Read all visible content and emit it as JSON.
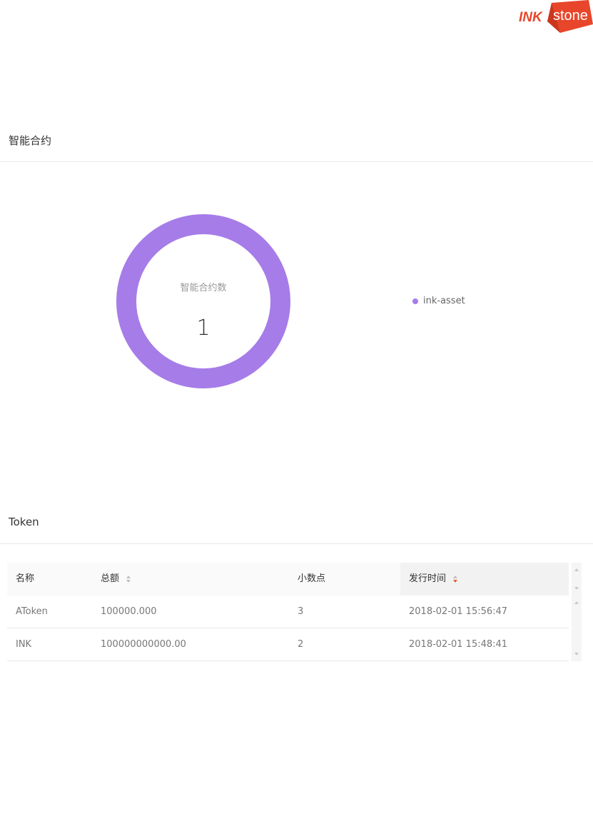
{
  "brand": {
    "logo_prefix": "INK",
    "logo_text": "stone",
    "color_primary": "#e8462b",
    "color_secondary": "#f26b2e"
  },
  "contracts_section": {
    "title": "智能合约"
  },
  "donut": {
    "center_label": "智能合约数",
    "center_value": "1",
    "legend": [
      {
        "name": "ink-asset",
        "color": "#a67ce8",
        "value": 1
      }
    ]
  },
  "token_section": {
    "title": "Token"
  },
  "table": {
    "columns": [
      {
        "label": "名称",
        "sortable": false
      },
      {
        "label": "总额",
        "sortable": true
      },
      {
        "label": "小数点",
        "sortable": false
      },
      {
        "label": "发行时间",
        "sortable": true,
        "sort_order": "descending"
      }
    ],
    "rows": [
      [
        "AToken",
        "100000.000",
        "3",
        "2018-02-01 15:56:47"
      ],
      [
        "INK",
        "100000000000.00",
        "2",
        "2018-02-01 15:48:41"
      ]
    ],
    "sort_active_color": "#e8602c"
  }
}
